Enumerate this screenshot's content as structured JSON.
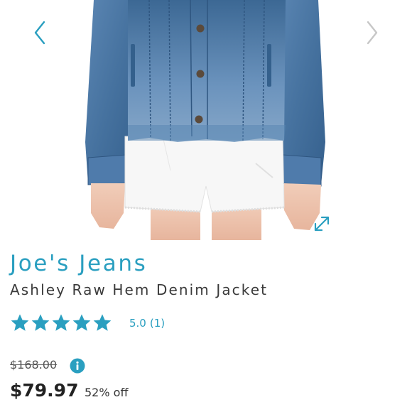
{
  "gallery": {
    "image_alt": "Ashley Raw Hem Denim Jacket product photo",
    "prev_icon": "chevron-left-icon",
    "next_icon": "chevron-right-icon",
    "expand_icon": "expand-icon"
  },
  "product": {
    "brand": "Joe's Jeans",
    "name": "Ashley Raw Hem Denim Jacket"
  },
  "rating": {
    "value": 5.0,
    "value_text": "5.0",
    "count_text": "(1)",
    "stars": 5,
    "star_icon": "star-icon"
  },
  "price": {
    "original": "$168.00",
    "sale": "$79.97",
    "discount": "52% off",
    "info_icon": "info-icon"
  },
  "colors": {
    "accent": "#2a9fc0",
    "denim": "#4a79a8",
    "text": "#222222"
  }
}
